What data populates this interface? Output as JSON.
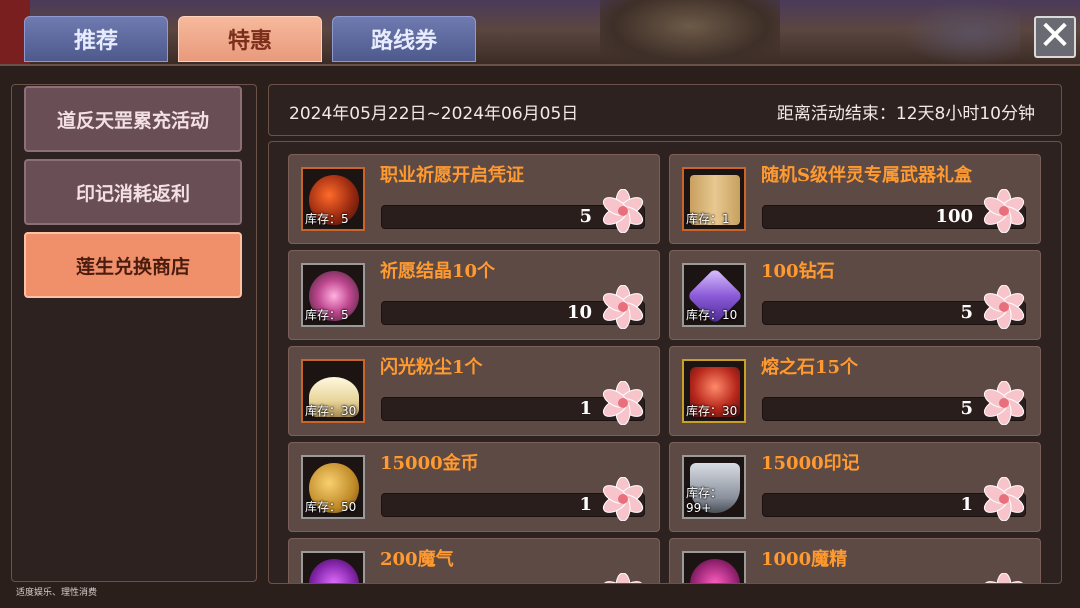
{
  "tabs": [
    {
      "label": "推荐",
      "active": false
    },
    {
      "label": "特惠",
      "active": true
    },
    {
      "label": "路线券",
      "active": false
    }
  ],
  "close": {
    "glyph": "✕"
  },
  "sidebar": {
    "items": [
      {
        "label": "道反天罡累充活动",
        "active": false
      },
      {
        "label": "印记消耗返利",
        "active": false
      },
      {
        "label": "莲生兑换商店",
        "active": true
      }
    ]
  },
  "event": {
    "date_range": "2024年05月22日~2024年06月05日",
    "countdown": "距离活动结束：12天8小时10分钟"
  },
  "shop": {
    "currency_icon": "lotus-flower-icon",
    "items": [
      {
        "name": "职业祈愿开启凭证",
        "stock": "库存：5",
        "cost": "5",
        "icon": "wish-orb-icon"
      },
      {
        "name": "随机S级伴灵专属武器礼盒",
        "stock": "库存：1",
        "cost": "100",
        "icon": "gift-box-icon"
      },
      {
        "name": "祈愿结晶10个",
        "stock": "库存：5",
        "cost": "10",
        "icon": "wish-crystal-icon"
      },
      {
        "name": "100钻石",
        "stock": "库存：10",
        "cost": "5",
        "icon": "diamond-icon"
      },
      {
        "name": "闪光粉尘1个",
        "stock": "库存：30",
        "cost": "1",
        "icon": "sparkle-dust-icon"
      },
      {
        "name": "熔之石15个",
        "stock": "库存：30",
        "cost": "5",
        "icon": "melt-stone-icon"
      },
      {
        "name": "15000金币",
        "stock": "库存：50",
        "cost": "1",
        "icon": "gold-coin-icon"
      },
      {
        "name": "15000印记",
        "stock": "库存：99+",
        "cost": "1",
        "icon": "emblem-icon"
      },
      {
        "name": "200魔气",
        "stock": "",
        "cost": "",
        "icon": "magic-aura-icon"
      },
      {
        "name": "1000魔精",
        "stock": "",
        "cost": "",
        "icon": "magic-essence-icon"
      }
    ]
  },
  "footer": {
    "notice": "适度娱乐、理性消费"
  }
}
